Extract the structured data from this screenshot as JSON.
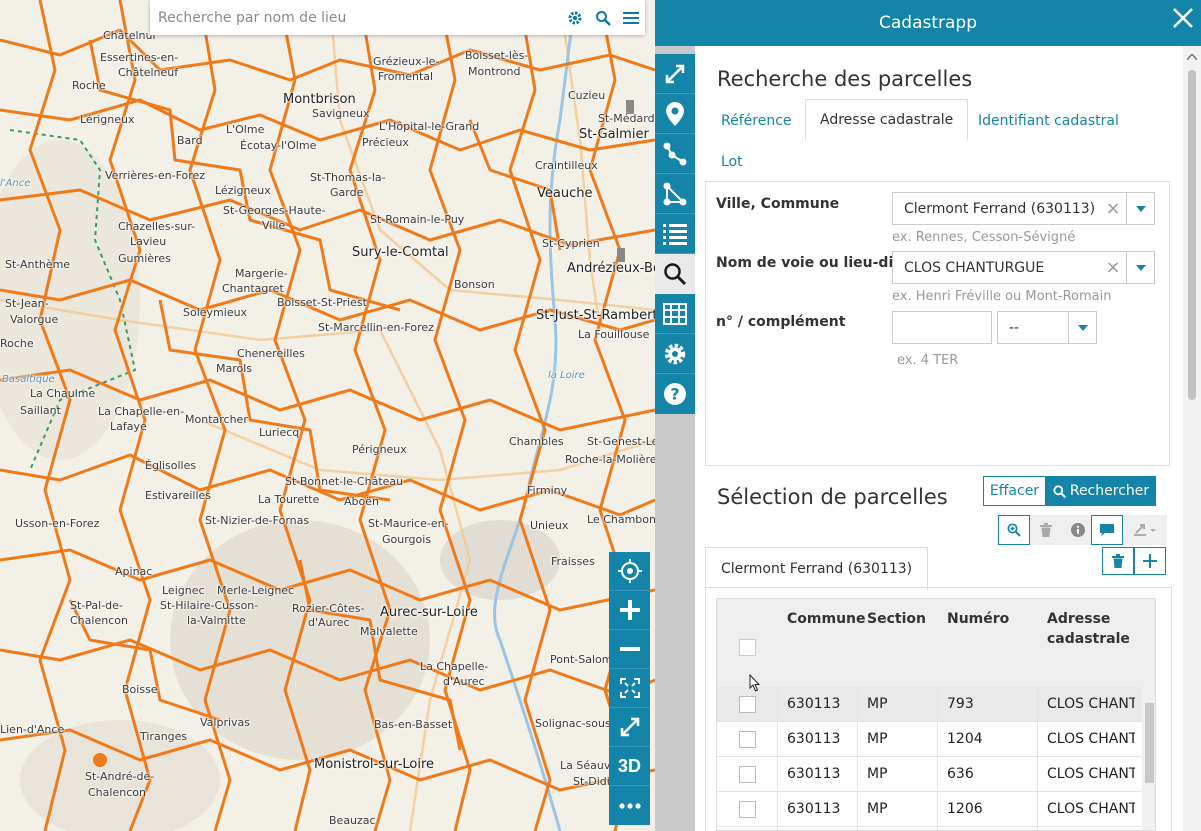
{
  "map": {
    "search_placeholder": "Recherche par nom de lieu",
    "places": [
      {
        "name": "Châtelnur"
      },
      {
        "name": "Essertines-en-"
      },
      {
        "name": "Châtelneuf"
      },
      {
        "name": "Roche"
      },
      {
        "name": "Lérigneux"
      },
      {
        "name": "Bard"
      },
      {
        "name": "L'Olme"
      },
      {
        "name": "Montbrison"
      },
      {
        "name": "Savigneux"
      },
      {
        "name": "Écotay-l'Olme"
      },
      {
        "name": "Grézieux-le-"
      },
      {
        "name": "Fromental"
      },
      {
        "name": "Boisset-lès-"
      },
      {
        "name": "Montrond"
      },
      {
        "name": "L'Hôpital-le-Grand"
      },
      {
        "name": "Précieux"
      },
      {
        "name": "Cuzieu"
      },
      {
        "name": "St-Médard"
      },
      {
        "name": "St-Galmier"
      },
      {
        "name": "Craintilleux"
      },
      {
        "name": "Verrières-en-Forez"
      },
      {
        "name": "St-Thomas-la-"
      },
      {
        "name": "Garde"
      },
      {
        "name": "Veauche"
      },
      {
        "name": "Lézigneux"
      },
      {
        "name": "St-Georges-Haute-"
      },
      {
        "name": "Ville"
      },
      {
        "name": "St-Romain-le-Puy"
      },
      {
        "name": "Chazelles-sur-"
      },
      {
        "name": "Lavieu"
      },
      {
        "name": "Gumières"
      },
      {
        "name": "St-Cyprien"
      },
      {
        "name": "Sury-le-Comtal"
      },
      {
        "name": "St-Anthème"
      },
      {
        "name": "Andrézieux-Bo"
      },
      {
        "name": "Margerie-"
      },
      {
        "name": "Chantagret"
      },
      {
        "name": "Boisset-St-Priest"
      },
      {
        "name": "Bonson"
      },
      {
        "name": "St-Jean-"
      },
      {
        "name": "Valorgue"
      },
      {
        "name": "Soleymieux"
      },
      {
        "name": "St-Just-St-Rambert"
      },
      {
        "name": "St-Marcellin-en-Forez"
      },
      {
        "name": "La Fouillouse"
      },
      {
        "name": "Roche"
      },
      {
        "name": "Chenereilles"
      },
      {
        "name": "Marols"
      },
      {
        "name": "Basaltique"
      },
      {
        "name": "La Chaulme"
      },
      {
        "name": "Saillant"
      },
      {
        "name": "La Chapelle-en-"
      },
      {
        "name": "Lafaye"
      },
      {
        "name": "Montarcher"
      },
      {
        "name": "Luriecq"
      },
      {
        "name": "Périgneux"
      },
      {
        "name": "Chambles"
      },
      {
        "name": "St-Genest-Le"
      },
      {
        "name": "Roche-la-Molière"
      },
      {
        "name": "Églisolles"
      },
      {
        "name": "St-Bonnet-le-Château"
      },
      {
        "name": "Estivareilles"
      },
      {
        "name": "La Tourette"
      },
      {
        "name": "Aboën"
      },
      {
        "name": "Firminy"
      },
      {
        "name": "Unieux"
      },
      {
        "name": "Usson-en-Forez"
      },
      {
        "name": "St-Nizier-de-Fornas"
      },
      {
        "name": "St-Maurice-en-"
      },
      {
        "name": "Gourgois"
      },
      {
        "name": "Le Chambon-"
      },
      {
        "name": "Apinac"
      },
      {
        "name": "Fraisses"
      },
      {
        "name": "Leignec"
      },
      {
        "name": "Merle-Leignec"
      },
      {
        "name": "St-Pal-de-"
      },
      {
        "name": "Chalencon"
      },
      {
        "name": "St-Hilaire-Cusson-"
      },
      {
        "name": "la-Valmitte"
      },
      {
        "name": "Rozier-Côtes-"
      },
      {
        "name": "d'Aurec"
      },
      {
        "name": "Aurec-sur-Loire"
      },
      {
        "name": "Malvalette"
      },
      {
        "name": "Pont-Salomon"
      },
      {
        "name": "La Chapelle-"
      },
      {
        "name": "d'Aurec"
      },
      {
        "name": "Boisse"
      },
      {
        "name": "Valprivas"
      },
      {
        "name": "Tiranges"
      },
      {
        "name": "Bas-en-Basset"
      },
      {
        "name": "Solignac-sous-Roche"
      },
      {
        "name": "Monistrol-sur-Loire"
      },
      {
        "name": "St-André-de-"
      },
      {
        "name": "Chalencon"
      },
      {
        "name": "Beauzac"
      },
      {
        "name": "La Séauve-"
      },
      {
        "name": "St-Didier"
      },
      {
        "name": "Lien-d'Ance"
      },
      {
        "name": "la Loire"
      },
      {
        "name": "l'Ance"
      }
    ],
    "tools": [
      {
        "name": "locate",
        "glyph": "⌖"
      },
      {
        "name": "zoom-in",
        "glyph": "+"
      },
      {
        "name": "zoom-out",
        "glyph": "−"
      },
      {
        "name": "zoom-extent",
        "glyph": "⤧"
      },
      {
        "name": "fullscreen",
        "glyph": "⤢"
      },
      {
        "name": "3d",
        "glyph": "3D"
      },
      {
        "name": "more",
        "glyph": "•••"
      }
    ]
  },
  "panel": {
    "title": "Cadastrapp",
    "search_heading": "Recherche des parcelles",
    "tabs": [
      "Référence",
      "Adresse cadastrale",
      "Identifiant cadastral",
      "Lot"
    ],
    "active_tab": "Adresse cadastrale",
    "form": {
      "city_label": "Ville, Commune",
      "city_value": "Clermont Ferrand (630113)",
      "city_hint": "ex. Rennes, Cesson-Sévigné",
      "street_label": "Nom de voie ou lieu-dit",
      "street_value": "CLOS CHANTURGUE",
      "street_hint": "ex. Henri Fréville ou Mont-Romain",
      "number_label": "n° / complément",
      "number_value": "",
      "complement_value": "--",
      "number_hint": "ex. 4 TER"
    },
    "clear_label": "Effacer",
    "search_label": "Rechercher",
    "selection_heading": "Sélection de parcelles",
    "result_tab": "Clermont Ferrand (630113)",
    "table": {
      "columns": [
        "Commune",
        "Section",
        "Numéro",
        "Adresse cadastrale"
      ],
      "rows": [
        {
          "commune": "630113",
          "section": "MP",
          "numero": "793",
          "adresse": "CLOS CHANT"
        },
        {
          "commune": "630113",
          "section": "MP",
          "numero": "1204",
          "adresse": "CLOS CHANT"
        },
        {
          "commune": "630113",
          "section": "MP",
          "numero": "636",
          "adresse": "CLOS CHANT"
        },
        {
          "commune": "630113",
          "section": "MP",
          "numero": "1206",
          "adresse": "CLOS CHANT"
        }
      ]
    }
  },
  "colors": {
    "accent": "#1485a8",
    "parcel_border": "#f07a1a",
    "road": "#f7d9a8"
  }
}
